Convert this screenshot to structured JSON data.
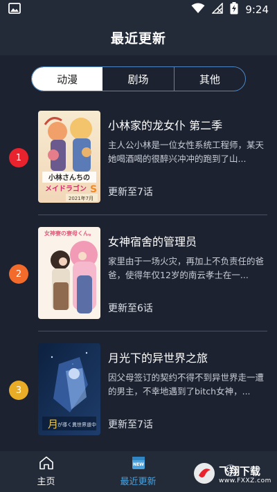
{
  "status_bar": {
    "time": "9:24",
    "icons": [
      "image-icon",
      "wifi-icon",
      "signal-icon",
      "battery-icon"
    ]
  },
  "header": {
    "title": "最近更新"
  },
  "tabs": [
    {
      "label": "动漫",
      "active": true
    },
    {
      "label": "剧场",
      "active": false
    },
    {
      "label": "其他",
      "active": false
    }
  ],
  "items": [
    {
      "rank": "1",
      "rank_color": "#e8232d",
      "title": "小林家的龙女仆 第二季",
      "description": "主人公小林是一位女性系统工程师，某天她喝酒喝的很醉兴冲冲的跑到了山...",
      "progress": "更新至7话",
      "cover_text": "小林さんちの メイドラゴンS",
      "cover_sub": "2021年7月"
    },
    {
      "rank": "2",
      "rank_color": "#f26b2b",
      "title": "女神宿舍的管理员",
      "description": "家里由于一场火灾，再加上不负责任的爸爸，使得年仅12岁的南云孝士在一...",
      "progress": "更新至6话",
      "cover_text": "女神寮の寮母くん。"
    },
    {
      "rank": "3",
      "rank_color": "#e9ac27",
      "title": "月光下的异世界之旅",
      "description": "因父母签订的契约不得不到异世界走一遭的男主，不幸地遇到了bitch女神，...",
      "progress": "更新至7话",
      "cover_text": "月が導く異世界道中"
    }
  ],
  "bottom_nav": [
    {
      "label": "主页",
      "icon": "home-icon",
      "active": false
    },
    {
      "label": "最近更新",
      "icon": "new-icon",
      "active": true,
      "badge": "NEW"
    },
    {
      "label": "",
      "icon": "extra-icon",
      "active": false
    }
  ],
  "watermark": {
    "text": "飞翔下载",
    "sub": "www.FXXZ.com"
  },
  "colors": {
    "background": "#1c2230",
    "bar": "#232a38",
    "accent": "#4aa3df",
    "tab_border": "#4d88c4"
  }
}
